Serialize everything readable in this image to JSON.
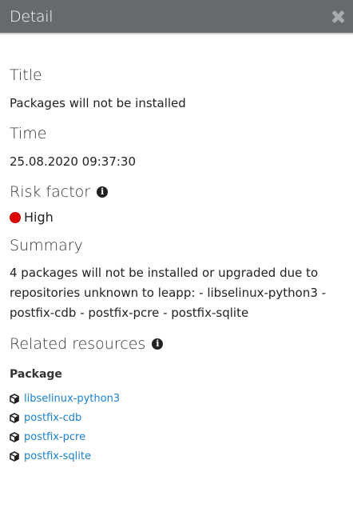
{
  "header": {
    "title": "Detail",
    "close_icon": "close-icon"
  },
  "fields": {
    "title_label": "Title",
    "title_value": "Packages will not be installed",
    "time_label": "Time",
    "time_value": "25.08.2020 09:37:30",
    "risk_label": "Risk factor",
    "risk_value": "High",
    "risk_color": "#d00000",
    "summary_label": "Summary",
    "summary_value": "4 packages will not be installed or upgraded due to repositories unknown to leapp: - libselinux-python3 - postfix-cdb - postfix-pcre - postfix-sqlite",
    "related_label": "Related resources",
    "info_icon_glyph": "i"
  },
  "related": {
    "group_label": "Package",
    "items": [
      "libselinux-python3",
      "postfix-cdb",
      "postfix-pcre",
      "postfix-sqlite"
    ],
    "link_color": "#1a7fc9"
  }
}
